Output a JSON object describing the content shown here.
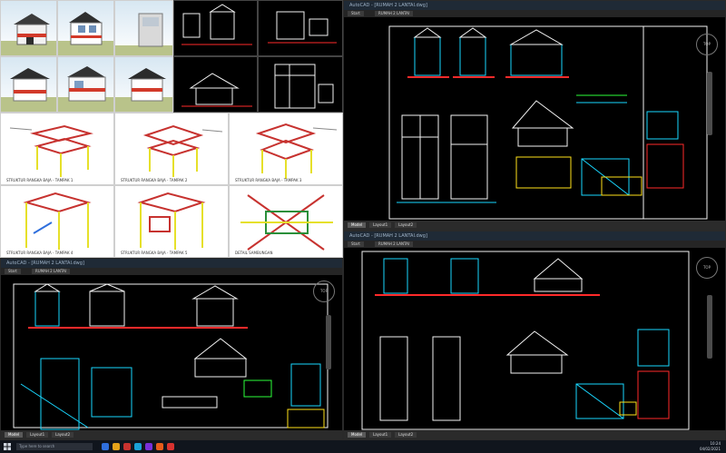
{
  "taskbar": {
    "search_placeholder": "Type here to search",
    "time": "10:24",
    "date": "04/02/2021",
    "app_colors": [
      "#2f6fdd",
      "#e3a21a",
      "#c7322f",
      "#19a0d6",
      "#7a2fd8",
      "#e65b1a",
      "#d7322f"
    ]
  },
  "gallery": {
    "captions": [
      "STRUKTUR RANGKA BAJA - TAMPAK 1",
      "STRUKTUR RANGKA BAJA - TAMPAK 2",
      "STRUKTUR RANGKA BAJA - TAMPAK 3",
      "STRUKTUR RANGKA BAJA - TAMPAK 4",
      "STRUKTUR RANGKA BAJA - TAMPAK 5",
      "DETAIL SAMBUNGAN"
    ]
  },
  "cad_windows": [
    {
      "title": "AutoCAD - [RUMAH 2 LANTAI.dwg]",
      "tabs": [
        "Start",
        "RUMAH 2 LANTAI"
      ],
      "model": "Model",
      "layouts": [
        "Layout1",
        "Layout2"
      ]
    },
    {
      "title": "AutoCAD - [RUMAH 2 LANTAI.dwg]",
      "tabs": [
        "Start",
        "RUMAH 2 LANTAI"
      ],
      "model": "Model",
      "layouts": [
        "Layout1",
        "Layout2"
      ]
    },
    {
      "title": "AutoCAD - [RUMAH 2 LANTAI.dwg]",
      "tabs": [
        "Start",
        "RUMAH 2 LANTAI"
      ],
      "model": "Model",
      "layouts": [
        "Layout1",
        "Layout2"
      ]
    }
  ],
  "colors": {
    "cad_cyan": "#19d7ff",
    "cad_red": "#ff2a2a",
    "cad_yellow": "#ffe21a",
    "cad_green": "#2dff3a",
    "cad_white": "#f2f2f2"
  }
}
